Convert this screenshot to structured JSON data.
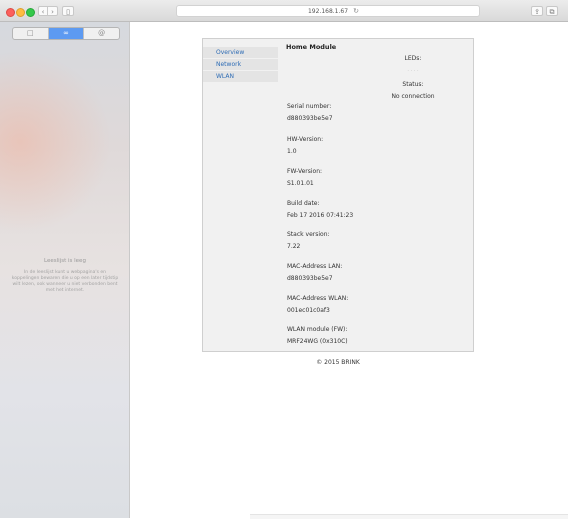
{
  "browser": {
    "url": "192.168.1.67",
    "reload_glyph": "↻",
    "back_glyph": "‹",
    "forward_glyph": "›",
    "sidebar_glyph": "▯",
    "share_glyph": "⇪",
    "tabs_glyph": "⧉"
  },
  "sidebar": {
    "tabs": [
      {
        "label": "□",
        "icon": "bookmarks-icon"
      },
      {
        "label": "∞",
        "icon": "reading-list-icon"
      },
      {
        "label": "@",
        "icon": "shared-links-icon"
      }
    ],
    "empty_title": "Leeslijst is leeg",
    "empty_body": "In de leeslijst kunt u webpagina's en koppelingen bewaren die u op een later tijdstip wilt lezen, ook wanneer u niet verbonden bent met het internet."
  },
  "page": {
    "nav": [
      "Overview",
      "Network",
      "WLAN"
    ],
    "module_title": "Home Module",
    "leds_label": "LEDs:",
    "leds_value": "· · · ·",
    "status_label": "Status:",
    "status_value": "No connection",
    "fields": [
      {
        "label": "Serial number:",
        "value": "d880393be5e7"
      },
      {
        "label": "HW-Version:",
        "value": "1.0"
      },
      {
        "label": "FW-Version:",
        "value": "S1.01.01"
      },
      {
        "label": "Build date:",
        "value": "Feb 17 2016 07:41:23"
      },
      {
        "label": "Stack version:",
        "value": "7.22"
      },
      {
        "label": "MAC-Address LAN:",
        "value": "d880393be5e7"
      },
      {
        "label": "MAC-Address WLAN:",
        "value": "001ec01c0af3"
      },
      {
        "label": "WLAN module (FW):",
        "value": "MRF24WG (0x310C)"
      }
    ],
    "footer": "© 2015 BRINK"
  }
}
